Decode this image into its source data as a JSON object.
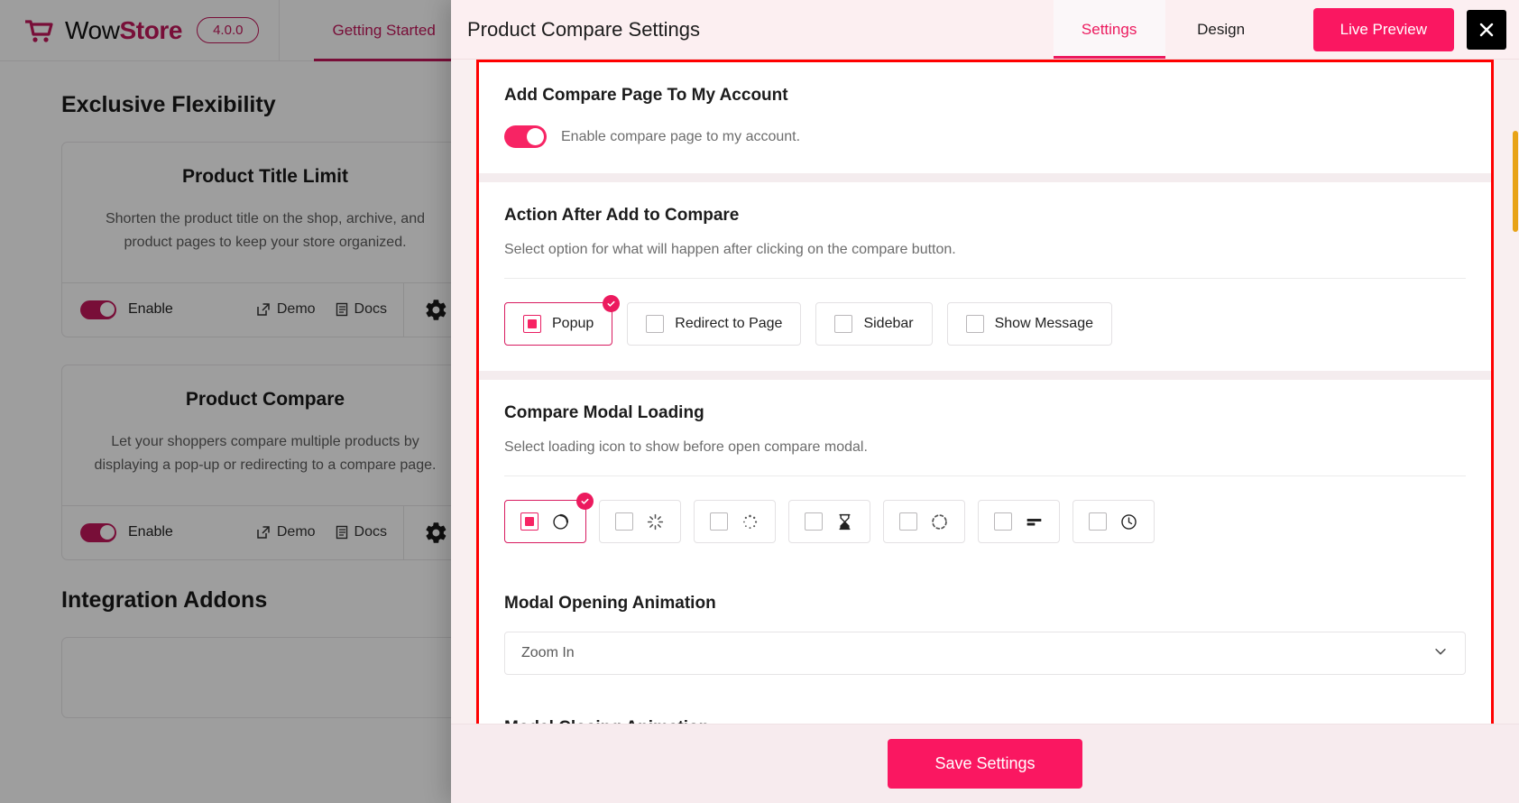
{
  "background": {
    "brand": {
      "name_part1": "Wow",
      "name_part2": "Store",
      "version": "4.0.0"
    },
    "nav_tab": "Getting Started",
    "heading": "Exclusive Flexibility",
    "heading2": "Integration Addons",
    "cards": [
      {
        "title": "Product Title Limit",
        "desc": "Shorten the product title on the shop, archive, and product pages to keep your store organized.",
        "enable_label": "Enable",
        "demo_label": "Demo",
        "docs_label": "Docs"
      },
      {
        "title": "Product Compare",
        "desc": "Let your shoppers compare multiple products by displaying a pop-up or redirecting to a compare page.",
        "enable_label": "Enable",
        "demo_label": "Demo",
        "docs_label": "Docs"
      }
    ]
  },
  "modal": {
    "title": "Product Compare Settings",
    "tabs": [
      {
        "label": "Settings",
        "active": true
      },
      {
        "label": "Design",
        "active": false
      }
    ],
    "live_preview_label": "Live Preview",
    "close_label": "✕",
    "save_label": "Save Settings",
    "sections": {
      "account": {
        "title": "Add Compare Page To My Account",
        "toggle_label": "Enable compare page to my account.",
        "toggle_on": true
      },
      "action": {
        "title": "Action After Add to Compare",
        "desc": "Select option for what will happen after clicking on the compare button.",
        "options": [
          {
            "label": "Popup",
            "selected": true
          },
          {
            "label": "Redirect to Page",
            "selected": false
          },
          {
            "label": "Sidebar",
            "selected": false
          },
          {
            "label": "Show Message",
            "selected": false
          }
        ]
      },
      "loading": {
        "title": "Compare Modal Loading",
        "desc": "Select loading icon to show before open compare modal.",
        "options": [
          {
            "icon": "spinner-ring-icon",
            "selected": true
          },
          {
            "icon": "spinner-rays-icon",
            "selected": false
          },
          {
            "icon": "spinner-dots-circle-icon",
            "selected": false
          },
          {
            "icon": "spinner-hourglass-icon",
            "selected": false
          },
          {
            "icon": "spinner-dashed-circle-icon",
            "selected": false
          },
          {
            "icon": "spinner-bars-icon",
            "selected": false
          },
          {
            "icon": "spinner-clock-icon",
            "selected": false
          }
        ]
      },
      "opening_animation": {
        "title": "Modal Opening Animation",
        "value": "Zoom In"
      },
      "closing_animation": {
        "title": "Modal Closing Animation"
      }
    }
  },
  "colors": {
    "accent": "#FA1761",
    "brand": "#C2185B",
    "highlight_outline": "#FF0000",
    "scrollbar": "#E8A317"
  }
}
